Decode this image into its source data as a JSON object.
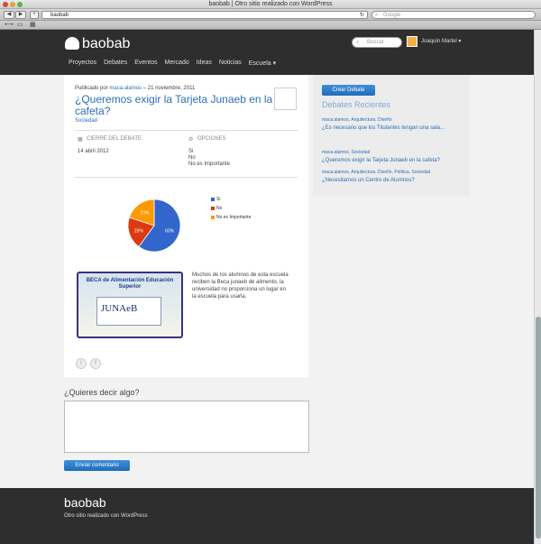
{
  "browser": {
    "window_title": "baobab | Otro sitio realizado con WordPress",
    "url": "baobab",
    "search_placeholder": "Google"
  },
  "site": {
    "logo": "baobab",
    "search_placeholder": "Buscar",
    "user": "Joaquín Martel ▾",
    "nav": [
      "Proyectos",
      "Debates",
      "Eventos",
      "Mercado",
      "Ideas",
      "Noticias",
      "Escuela ▾"
    ]
  },
  "post": {
    "published_prefix": "Publicado por",
    "author": "maca.alamos",
    "date_sep": "– 21 noviembre, 2011",
    "title": "¿Queremos exigir la Tarjeta Junaeb en la cafeta?",
    "tag": "Sociedad",
    "close_label": "CIERRE DEL DEBATE",
    "close_date": "14 abril 2012",
    "options_label": "OPCIONES",
    "options": [
      "Si",
      "No",
      "No es Importante"
    ],
    "body": "Muchos de los alumnos de esta escuela reciben la Beca junaeb de alimento, la universidad no proporciona un lugar en la escuela para usarla.",
    "image_title": "BECA de Alimentación Educación Superior",
    "image_logo": "JUNAeB"
  },
  "chart_data": {
    "type": "pie",
    "categories": [
      "Si",
      "No",
      "No es Importante"
    ],
    "values": [
      60,
      20,
      20
    ],
    "labels": [
      "60%",
      "20%",
      "20%"
    ],
    "colors": [
      "#3366cc",
      "#dc3912",
      "#ff9900"
    ],
    "legend": "right"
  },
  "sidebar": {
    "create_button": "Crear Debate",
    "heading": "Debates Recientes",
    "items": [
      {
        "meta": "maca.alamos, Arquitectura, Diseño",
        "title": "¿Es necesario que los Titulantes tengan una sala..."
      },
      {
        "meta": "maca.alamos, Sociedad",
        "title": "¿Queremos exigir la Tarjeta Junaeb en la cafeta?"
      },
      {
        "meta": "maca.alamos, Arquitectura, Diseño, Política, Sociedad",
        "title": "¿Necesitamos un Centro de Alumnos?"
      }
    ]
  },
  "comments": {
    "heading": "¿Quieres decir algo?",
    "submit": "Enviar comentario"
  },
  "footer": {
    "logo": "baobab",
    "tagline": "Otro sitio realizado con WordPress"
  }
}
